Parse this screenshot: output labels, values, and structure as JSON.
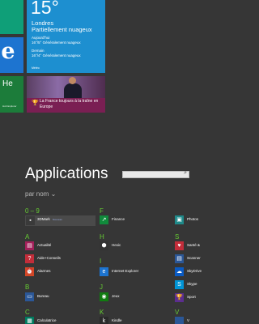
{
  "tiles": {
    "ie_letter": "e",
    "health": {
      "title": "Santé",
      "title_visible": "He",
      "subtitle": "Hub Explorer"
    },
    "weather": {
      "temperature": "15°",
      "city": "Londres",
      "condition": "Partiellement nuageux",
      "today_label": "Aujourd'hui",
      "today_forecast": "16°/5° Généralement nuageux",
      "tomorrow_label": "Demain",
      "tomorrow_forecast": "16°/4° Généralement nuageux",
      "app_name": "Météo"
    },
    "news": {
      "headline": "La France toujours à la traîne en Europe"
    }
  },
  "apps": {
    "title": "Applications",
    "search_placeholder": "",
    "sort_label": "par nom ⌄",
    "groups": [
      {
        "letter": "0 – 9"
      },
      {
        "letter": "A"
      },
      {
        "letter": "B"
      },
      {
        "letter": "C"
      },
      {
        "letter": "F"
      },
      {
        "letter": "H"
      },
      {
        "letter": "I"
      },
      {
        "letter": "J"
      },
      {
        "letter": "K"
      },
      {
        "letter": "S"
      },
      {
        "letter": "V"
      }
    ],
    "items": [
      {
        "label": "3DMark",
        "badge": "Nouveau",
        "icon": "3dmark-icon",
        "color": "#3a3a3a"
      },
      {
        "label": "Actualité",
        "icon": "news-icon",
        "color": "#a3205a"
      },
      {
        "label": "Aide+Conseils",
        "icon": "help-icon",
        "color": "#c22d3a"
      },
      {
        "label": "Alarmes",
        "icon": "alarm-icon",
        "color": "#d24726"
      },
      {
        "label": "Bureau",
        "icon": "desktop-icon",
        "color": "#2b5797"
      },
      {
        "label": "Calculatrice",
        "icon": "calculator-icon",
        "color": "#007a5e"
      },
      {
        "label": "Finance",
        "icon": "finance-icon",
        "color": "#108a3b"
      },
      {
        "label": "Hexic",
        "icon": "hexic-icon",
        "color": "#333333"
      },
      {
        "label": "Internet Explorer",
        "icon": "ie-icon",
        "color": "#1d74d0"
      },
      {
        "label": "Jeux",
        "icon": "games-icon",
        "color": "#107c10"
      },
      {
        "label": "Kindle",
        "icon": "kindle-icon",
        "color": "#2a2a2a"
      },
      {
        "label": "Photos",
        "icon": "photos-icon",
        "color": "#1f8a8a"
      },
      {
        "label": "Santé &",
        "icon": "health-icon",
        "color": "#c22d3a"
      },
      {
        "label": "Scanner",
        "icon": "scanner-icon",
        "color": "#2b5797"
      },
      {
        "label": "SkyDrive",
        "icon": "skydrive-icon",
        "color": "#0a5bc4"
      },
      {
        "label": "Skype",
        "icon": "skype-icon",
        "color": "#0094d6"
      },
      {
        "label": "Sport",
        "icon": "sport-icon",
        "color": "#5b2d90"
      },
      {
        "label": "V",
        "icon": "app-icon",
        "color": "#2b5797"
      }
    ]
  }
}
